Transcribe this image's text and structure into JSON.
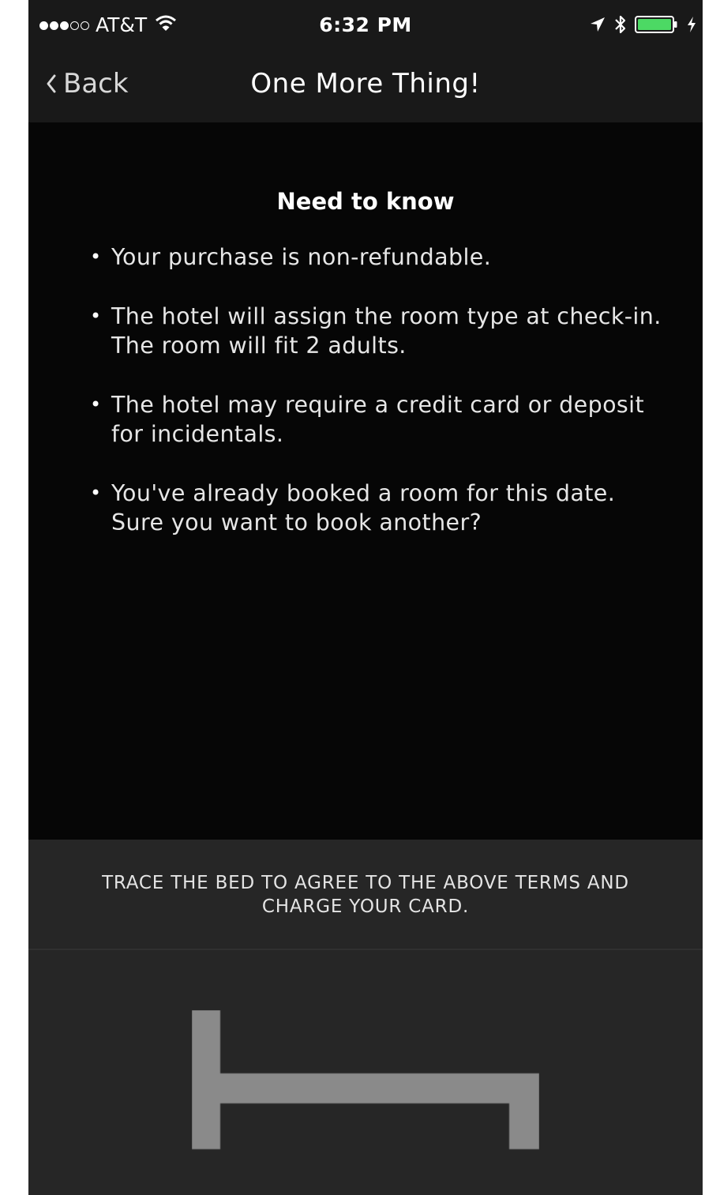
{
  "status_bar": {
    "signal": {
      "filled": 3,
      "total": 5
    },
    "carrier": "AT&T",
    "time": "6:32 PM",
    "battery_percent": 100,
    "icons": [
      "wifi-icon",
      "location-arrow-icon",
      "bluetooth-icon",
      "battery-icon",
      "charging-bolt-icon"
    ]
  },
  "nav": {
    "back_label": "Back",
    "title": "One More Thing!"
  },
  "content": {
    "heading": "Need to know",
    "bullets": [
      "Your purchase is non-refundable.",
      "The hotel will assign the room type at check-in. The room will fit 2 adults.",
      "The hotel may require a credit card or deposit for incidentals.",
      "You've already booked a room for this date. Sure you want to book another?"
    ],
    "bullet_symbol": "•"
  },
  "trace": {
    "instruction": "TRACE THE BED TO AGREE TO THE ABOVE TERMS AND CHARGE YOUR CARD.",
    "icon": "bed-outline-icon"
  },
  "colors": {
    "battery": "#4cd964",
    "bed": "#8a8a8a"
  }
}
